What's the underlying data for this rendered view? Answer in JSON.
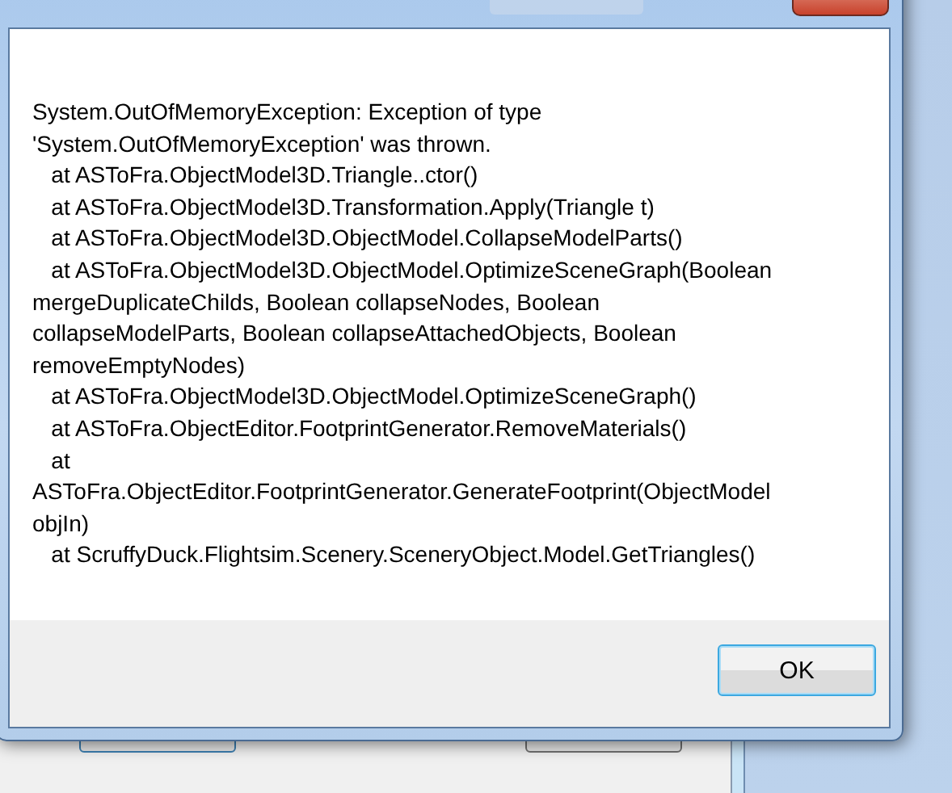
{
  "dialog": {
    "message_lines": [
      "System.OutOfMemoryException: Exception of type",
      "'System.OutOfMemoryException' was thrown.",
      "   at ASToFra.ObjectModel3D.Triangle..ctor()",
      "   at ASToFra.ObjectModel3D.Transformation.Apply(Triangle t)",
      "   at ASToFra.ObjectModel3D.ObjectModel.CollapseModelParts()",
      "   at ASToFra.ObjectModel3D.ObjectModel.OptimizeSceneGraph(Boolean",
      "mergeDuplicateChilds, Boolean collapseNodes, Boolean",
      "collapseModelParts, Boolean collapseAttachedObjects, Boolean",
      "removeEmptyNodes)",
      "   at ASToFra.ObjectModel3D.ObjectModel.OptimizeSceneGraph()",
      "   at ASToFra.ObjectEditor.FootprintGenerator.RemoveMaterials()",
      "   at",
      "ASToFra.ObjectEditor.FootprintGenerator.GenerateFootprint(ObjectModel",
      "objIn)",
      "   at ScruffyDuck.Flightsim.Scenery.SceneryObject.Model.GetTriangles()"
    ],
    "buttons": [
      {
        "label": "OK",
        "focused": true
      }
    ]
  }
}
